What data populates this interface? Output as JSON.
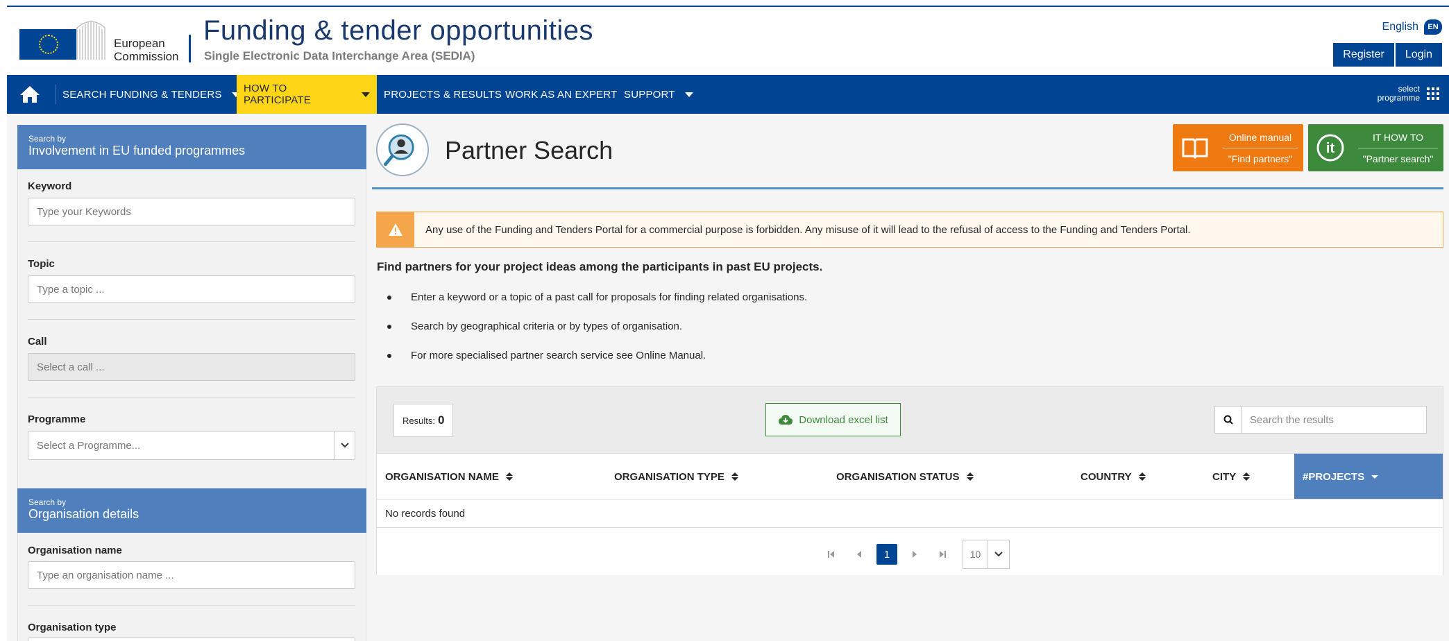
{
  "header": {
    "logo_line1": "European",
    "logo_line2": "Commission",
    "title": "Funding & tender opportunities",
    "subtitle": "Single Electronic Data Interchange Area (SEDIA)",
    "language": "English",
    "language_code": "EN",
    "register_label": "Register",
    "login_label": "Login"
  },
  "nav": {
    "items": [
      {
        "label": "SEARCH FUNDING & TENDERS",
        "dropdown": true
      },
      {
        "label": "HOW TO PARTICIPATE",
        "dropdown": true,
        "active": true
      },
      {
        "label": "PROJECTS & RESULTS"
      },
      {
        "label": "WORK AS AN EXPERT"
      },
      {
        "label": "SUPPORT",
        "dropdown": true
      }
    ],
    "select_programme_line1": "select",
    "select_programme_line2": "programme"
  },
  "sidebar": {
    "section1_small": "Search by",
    "section1_title": "Involvement in EU funded programmes",
    "keyword_label": "Keyword",
    "keyword_placeholder": "Type your Keywords",
    "topic_label": "Topic",
    "topic_placeholder": "Type a topic ...",
    "call_label": "Call",
    "call_placeholder": "Select a call ...",
    "programme_label": "Programme",
    "programme_placeholder": "Select a Programme...",
    "section2_small": "Search by",
    "section2_title": "Organisation details",
    "org_name_label": "Organisation name",
    "org_name_placeholder": "Type an organisation name ...",
    "org_type_label": "Organisation type"
  },
  "main": {
    "page_title": "Partner Search",
    "help_manual_line1": "Online manual",
    "help_manual_line2": "\"Find partners\"",
    "help_it_line1": "IT HOW TO",
    "help_it_line2": "\"Partner search\"",
    "warning": "Any use of the Funding and Tenders Portal for a commercial purpose is forbidden. Any misuse of it will lead to the refusal of access to the Funding and Tenders Portal.",
    "intro": "Find partners for your project ideas among the participants in past EU projects.",
    "bullets": [
      "Enter a keyword or a topic of a past call for proposals for finding related organisations.",
      "Search by geographical criteria or by types of organisation.",
      "For more specialised partner search service see Online Manual."
    ]
  },
  "results": {
    "count_label": "Results:",
    "count_value": "0",
    "download_label": "Download excel list",
    "search_placeholder": "Search the results",
    "columns": [
      "ORGANISATION NAME",
      "ORGANISATION TYPE",
      "ORGANISATION STATUS",
      "COUNTRY",
      "CITY",
      "#PROJECTS"
    ],
    "sorted_column": "#PROJECTS",
    "empty_message": "No records found",
    "current_page": "1",
    "page_size": "10"
  },
  "colors": {
    "primary": "#004494",
    "accent_yellow": "#ffd617",
    "sidebar_header": "#4f7fbd",
    "orange": "#ef7a11",
    "green": "#3d8a3d",
    "warning": "#f5a54a"
  }
}
